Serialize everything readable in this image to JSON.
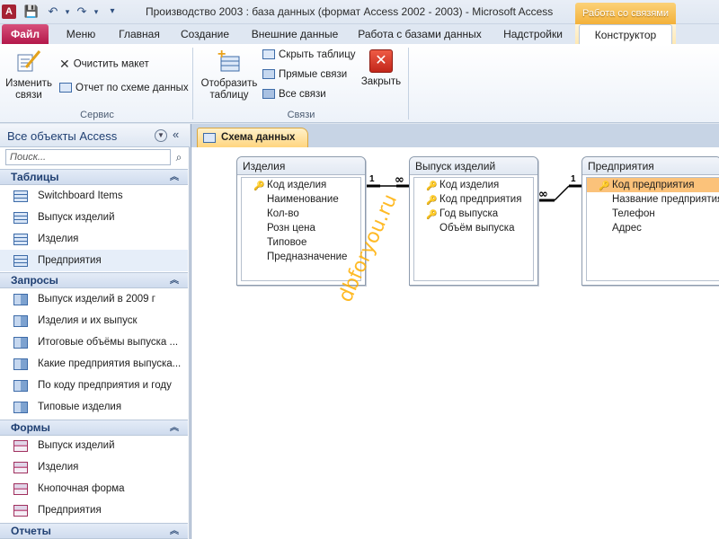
{
  "window": {
    "title": "Производство 2003 : база данных (формат Access 2002 - 2003)  -  Microsoft Access",
    "app_icon": "A",
    "context_tab_header": "Работа со связями"
  },
  "ribbon_tabs": [
    {
      "label": "Файл"
    },
    {
      "label": "Меню"
    },
    {
      "label": "Главная"
    },
    {
      "label": "Создание"
    },
    {
      "label": "Внешние данные"
    },
    {
      "label": "Работа с базами данных"
    },
    {
      "label": "Надстройки"
    },
    {
      "label": "Конструктор"
    }
  ],
  "ribbon": {
    "service": {
      "edit_links": "Изменить связи",
      "clear_layout": "Очистить макет",
      "report": "Отчет по схеме данных",
      "group_label": "Сервис"
    },
    "links": {
      "show_table": "Отобразить таблицу",
      "hide_table": "Скрыть таблицу",
      "direct_links": "Прямые связи",
      "all_links": "Все связи",
      "close": "Закрыть",
      "group_label": "Связи"
    }
  },
  "nav": {
    "title": "Все объекты Access",
    "search_placeholder": "Поиск...",
    "sections": [
      {
        "label": "Таблицы",
        "items": [
          "Switchboard Items",
          "Выпуск изделий",
          "Изделия",
          "Предприятия"
        ]
      },
      {
        "label": "Запросы",
        "items": [
          "Выпуск изделий в 2009 г",
          "Изделия и их выпуск",
          "Итоговые объёмы выпуска ...",
          "Какие предприятия выпуска...",
          "По коду предприятия и году",
          "Типовые изделия"
        ]
      },
      {
        "label": "Формы",
        "items": [
          "Выпуск изделий",
          "Изделия",
          "Кнопочная форма",
          "Предприятия"
        ]
      },
      {
        "label": "Отчеты",
        "items": []
      }
    ]
  },
  "document": {
    "tab_label": "Схема данных",
    "tables": [
      {
        "title": "Изделия",
        "fields": [
          {
            "name": "Код изделия",
            "key": true
          },
          {
            "name": "Наименование",
            "key": false
          },
          {
            "name": "Кол-во",
            "key": false
          },
          {
            "name": "Розн цена",
            "key": false
          },
          {
            "name": "Типовое",
            "key": false
          },
          {
            "name": "Предназначение",
            "key": false
          }
        ]
      },
      {
        "title": "Выпуск изделий",
        "fields": [
          {
            "name": "Код изделия",
            "key": true
          },
          {
            "name": "Код предприятия",
            "key": true
          },
          {
            "name": "Год выпуска",
            "key": true
          },
          {
            "name": "Объём выпуска",
            "key": false
          }
        ]
      },
      {
        "title": "Предприятия",
        "fields": [
          {
            "name": "Код предприятия",
            "key": true
          },
          {
            "name": "Название предприятия",
            "key": false
          },
          {
            "name": "Телефон",
            "key": false
          },
          {
            "name": "Адрес",
            "key": false
          }
        ]
      }
    ],
    "relations": [
      {
        "one": "1",
        "many": "∞"
      },
      {
        "one": "1",
        "many": "∞"
      }
    ],
    "watermark": "dbforyou.ru"
  }
}
